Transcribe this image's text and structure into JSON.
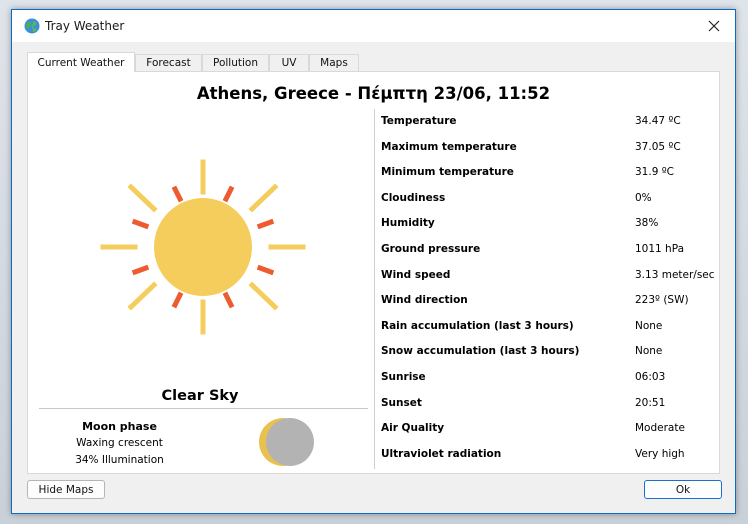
{
  "window": {
    "title": "Tray Weather"
  },
  "tabs": [
    "Current Weather",
    "Forecast",
    "Pollution",
    "UV",
    "Maps"
  ],
  "heading": "Athens, Greece - Πέμπτη 23/06, 11:52",
  "condition": "Clear Sky",
  "moon": {
    "title": "Moon phase",
    "phase": "Waxing crescent",
    "illumination": "34% Illumination",
    "illumination_fraction": 0.34
  },
  "details": [
    {
      "label": "Temperature",
      "value": "34.47 ºC"
    },
    {
      "label": "Maximum temperature",
      "value": "37.05 ºC"
    },
    {
      "label": "Minimum temperature",
      "value": "31.9 ºC"
    },
    {
      "label": "Cloudiness",
      "value": "0%"
    },
    {
      "label": "Humidity",
      "value": "38%"
    },
    {
      "label": "Ground pressure",
      "value": "1011 hPa"
    },
    {
      "label": "Wind speed",
      "value": "3.13 meter/sec"
    },
    {
      "label": "Wind direction",
      "value": "223º (SW)"
    },
    {
      "label": "Rain accumulation (last 3 hours)",
      "value": "None"
    },
    {
      "label": "Snow accumulation (last 3 hours)",
      "value": "None"
    },
    {
      "label": "Sunrise",
      "value": "06:03"
    },
    {
      "label": "Sunset",
      "value": "20:51"
    },
    {
      "label": "Air Quality",
      "value": "Moderate"
    },
    {
      "label": "Ultraviolet radiation",
      "value": "Very high"
    }
  ],
  "buttons": {
    "hide_maps": "Hide Maps",
    "ok": "Ok"
  },
  "icons": {
    "app": "globe-icon",
    "close": "close-icon",
    "weather": "sun-icon",
    "moon": "moon-icon"
  },
  "colors": {
    "sun": "#f5cd5c",
    "sun_rays_inner": "#ee5b2e",
    "accent": "#1c6fd1"
  }
}
